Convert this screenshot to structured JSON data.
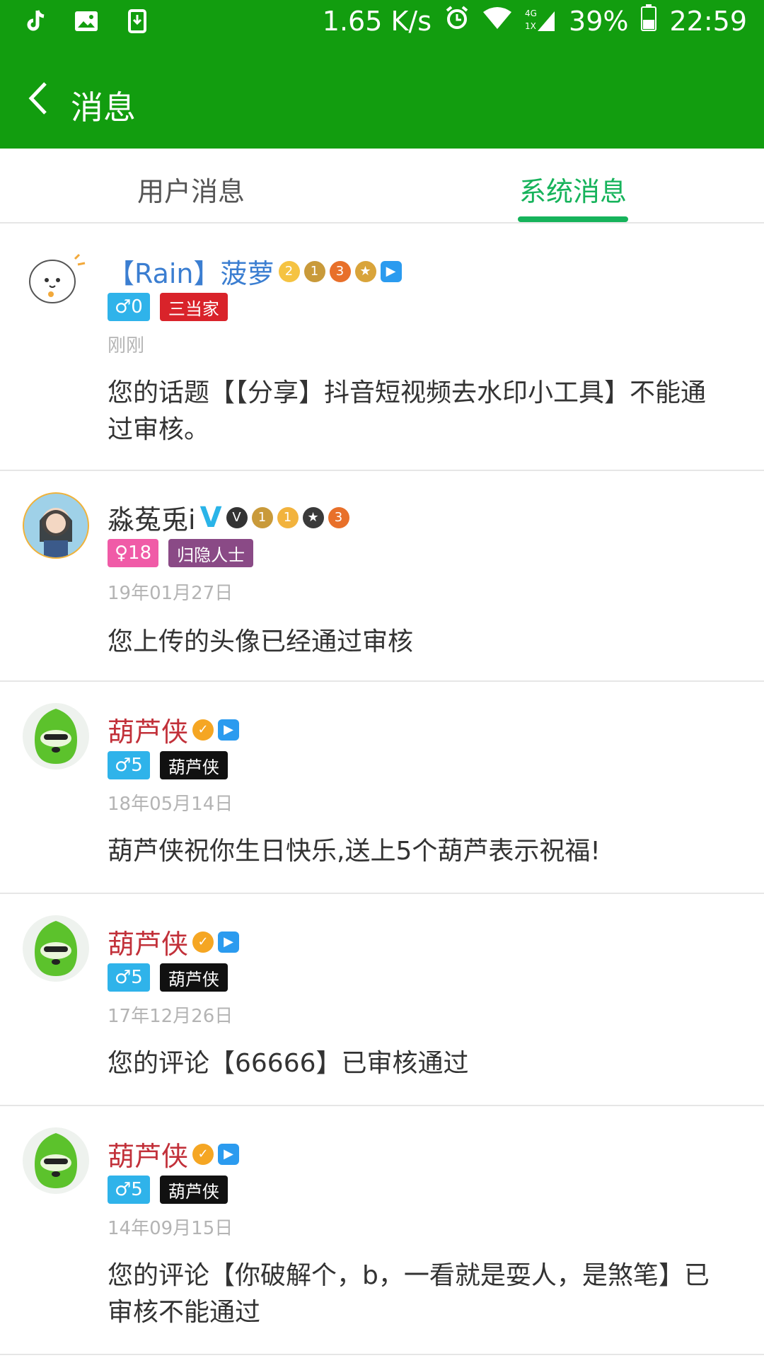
{
  "status_bar": {
    "speed": "1.65 K/s",
    "network": "4G",
    "sim": "1X",
    "battery": "39%",
    "time": "22:59"
  },
  "header": {
    "title": "消息"
  },
  "tabs": [
    {
      "label": "用户消息",
      "active": false
    },
    {
      "label": "系统消息",
      "active": true
    }
  ],
  "messages": [
    {
      "name": "【Rain】菠萝",
      "name_color": "#3b7ed1",
      "gender": "♂0",
      "gender_type": "male",
      "rank": "三当家",
      "rank_color": "#d9232a",
      "time": "刚刚",
      "content": "您的话题【【分享】抖音短视频去水印小工具】不能通过审核。"
    },
    {
      "name": "淼菟兎i",
      "name_color": "#333333",
      "gender": "♀18",
      "gender_type": "female",
      "rank": "归隐人士",
      "rank_color": "#8a4a86",
      "time": "19年01月27日",
      "content": "您上传的头像已经通过审核"
    },
    {
      "name": "葫芦侠",
      "name_color": "#c2313a",
      "gender": "♂5",
      "gender_type": "male",
      "rank": "葫芦侠",
      "rank_color": "#111111",
      "time": "18年05月14日",
      "content": "葫芦侠祝你生日快乐,送上5个葫芦表示祝福!"
    },
    {
      "name": "葫芦侠",
      "name_color": "#c2313a",
      "gender": "♂5",
      "gender_type": "male",
      "rank": "葫芦侠",
      "rank_color": "#111111",
      "time": "17年12月26日",
      "content": "您的评论【66666】已审核通过"
    },
    {
      "name": "葫芦侠",
      "name_color": "#c2313a",
      "gender": "♂5",
      "gender_type": "male",
      "rank": "葫芦侠",
      "rank_color": "#111111",
      "time": "14年09月15日",
      "content": "您的评论【你破解个，b，一看就是耍人，是煞笔】已审核不能通过"
    }
  ]
}
